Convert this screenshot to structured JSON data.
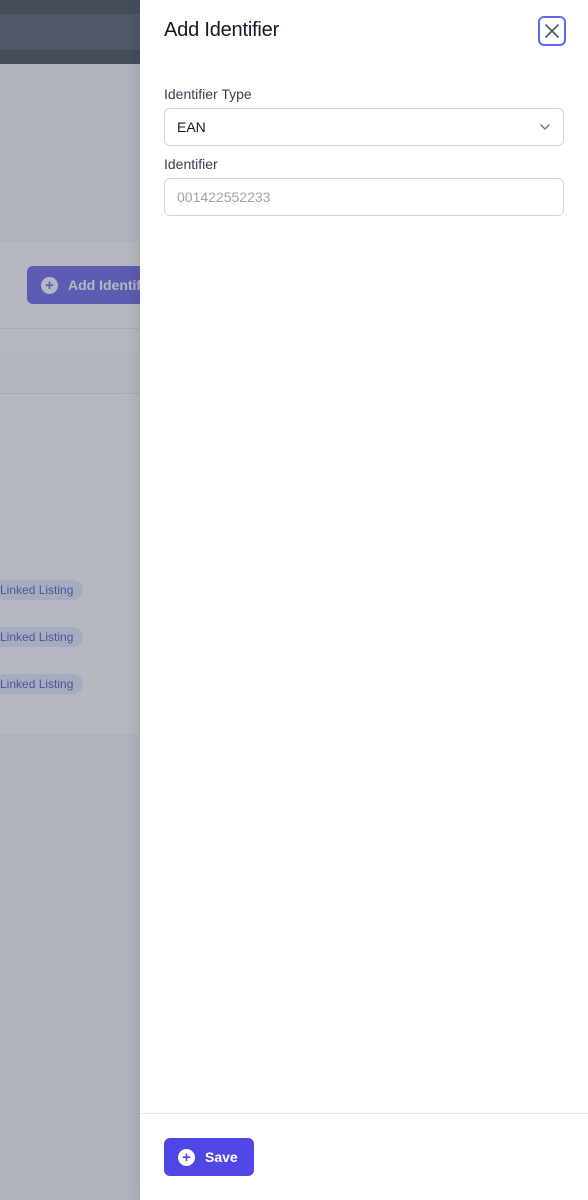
{
  "background": {
    "add_button_label": "Add Identifier",
    "linked_listing_badges": [
      "Linked Listing",
      "Linked Listing",
      "Linked Listing"
    ]
  },
  "panel": {
    "title": "Add Identifier",
    "identifier_type": {
      "label": "Identifier Type",
      "selected_value": "EAN"
    },
    "identifier": {
      "label": "Identifier",
      "placeholder": "001422552233",
      "value": ""
    },
    "save_label": "Save"
  },
  "icons": {
    "close": "close-icon",
    "chevron": "chevron-down-icon",
    "plus": "plus-circle-icon"
  },
  "colors": {
    "accent": "#4f46e5",
    "focus_ring": "#6366f1"
  }
}
